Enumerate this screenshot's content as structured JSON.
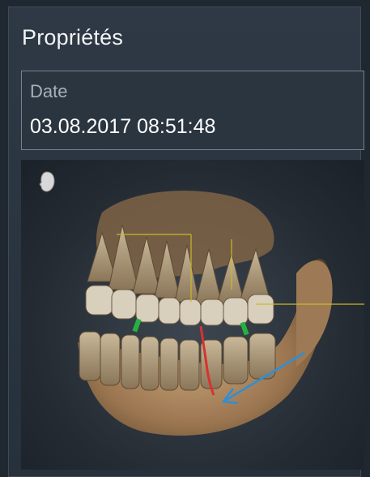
{
  "panel": {
    "title": "Propriétés"
  },
  "date_field": {
    "label": "Date",
    "value": "03.08.2017 08:51:48"
  },
  "viewer": {
    "orientation_icon": "head-orientation-icon",
    "colors": {
      "bone": "#b08a5e",
      "tooth": "#d8ccb4",
      "nerve_canal": "#d7322f",
      "arrow": "#2f8fd4",
      "crosshair": "#c9b92a",
      "marker": "#27b040"
    }
  }
}
